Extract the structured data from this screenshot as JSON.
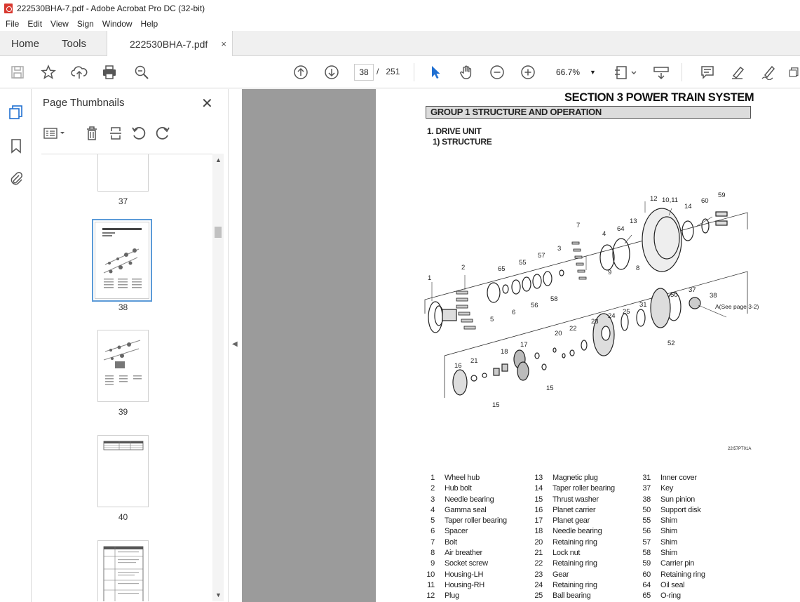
{
  "window": {
    "title": "222530BHA-7.pdf - Adobe Acrobat Pro DC (32-bit)"
  },
  "menu": [
    "File",
    "Edit",
    "View",
    "Sign",
    "Window",
    "Help"
  ],
  "tabs": {
    "home": "Home",
    "tools": "Tools",
    "doc": "222530BHA-7.pdf",
    "close": "×"
  },
  "toolbar": {
    "page_current": "38",
    "page_sep": "/",
    "page_total": "251",
    "zoom": "66.7%"
  },
  "panel": {
    "title": "Page Thumbnails",
    "thumbs": [
      {
        "label": "37"
      },
      {
        "label": "38"
      },
      {
        "label": "39"
      },
      {
        "label": "40"
      }
    ]
  },
  "document": {
    "section_title": "SECTION  3  POWER TRAIN SYSTEM",
    "group_title": "GROUP  1  STRUCTURE AND OPERATION",
    "heading1": "1. DRIVE UNIT",
    "heading2": "1) STRUCTURE",
    "figure_code": "22I57PT01A",
    "callouts": [
      "1",
      "2",
      "3",
      "4",
      "5",
      "6",
      "7",
      "8",
      "9",
      "10,11",
      "12",
      "13",
      "14",
      "15",
      "15",
      "16",
      "17",
      "18",
      "20",
      "21",
      "22",
      "23",
      "24",
      "25",
      "31",
      "37",
      "38",
      "50",
      "52",
      "55",
      "56",
      "57",
      "58",
      "59",
      "60",
      "64",
      "65",
      "A(See page 3-2)"
    ],
    "parts_columns": [
      [
        {
          "n": "1",
          "name": "Wheel hub"
        },
        {
          "n": "2",
          "name": "Hub bolt"
        },
        {
          "n": "3",
          "name": "Needle bearing"
        },
        {
          "n": "4",
          "name": "Gamma seal"
        },
        {
          "n": "5",
          "name": "Taper roller bearing"
        },
        {
          "n": "6",
          "name": "Spacer"
        },
        {
          "n": "7",
          "name": "Bolt"
        },
        {
          "n": "8",
          "name": "Air breather"
        },
        {
          "n": "9",
          "name": "Socket screw"
        },
        {
          "n": "10",
          "name": "Housing-LH"
        },
        {
          "n": "11",
          "name": "Housing-RH"
        },
        {
          "n": "12",
          "name": "Plug"
        }
      ],
      [
        {
          "n": "13",
          "name": "Magnetic plug"
        },
        {
          "n": "14",
          "name": "Taper roller bearing"
        },
        {
          "n": "15",
          "name": "Thrust washer"
        },
        {
          "n": "16",
          "name": "Planet carrier"
        },
        {
          "n": "17",
          "name": "Planet gear"
        },
        {
          "n": "18",
          "name": "Needle bearing"
        },
        {
          "n": "20",
          "name": "Retaining ring"
        },
        {
          "n": "21",
          "name": "Lock nut"
        },
        {
          "n": "22",
          "name": "Retaining ring"
        },
        {
          "n": "23",
          "name": "Gear"
        },
        {
          "n": "24",
          "name": "Retaining ring"
        },
        {
          "n": "25",
          "name": "Ball bearing"
        }
      ],
      [
        {
          "n": "31",
          "name": "Inner cover"
        },
        {
          "n": "37",
          "name": "Key"
        },
        {
          "n": "38",
          "name": "Sun pinion"
        },
        {
          "n": "50",
          "name": "Support disk"
        },
        {
          "n": "55",
          "name": "Shim"
        },
        {
          "n": "56",
          "name": "Shim"
        },
        {
          "n": "57",
          "name": "Shim"
        },
        {
          "n": "58",
          "name": "Shim"
        },
        {
          "n": "59",
          "name": "Carrier pin"
        },
        {
          "n": "60",
          "name": "Retaining ring"
        },
        {
          "n": "64",
          "name": "Oil seal"
        },
        {
          "n": "65",
          "name": "O-ring"
        }
      ]
    ]
  }
}
